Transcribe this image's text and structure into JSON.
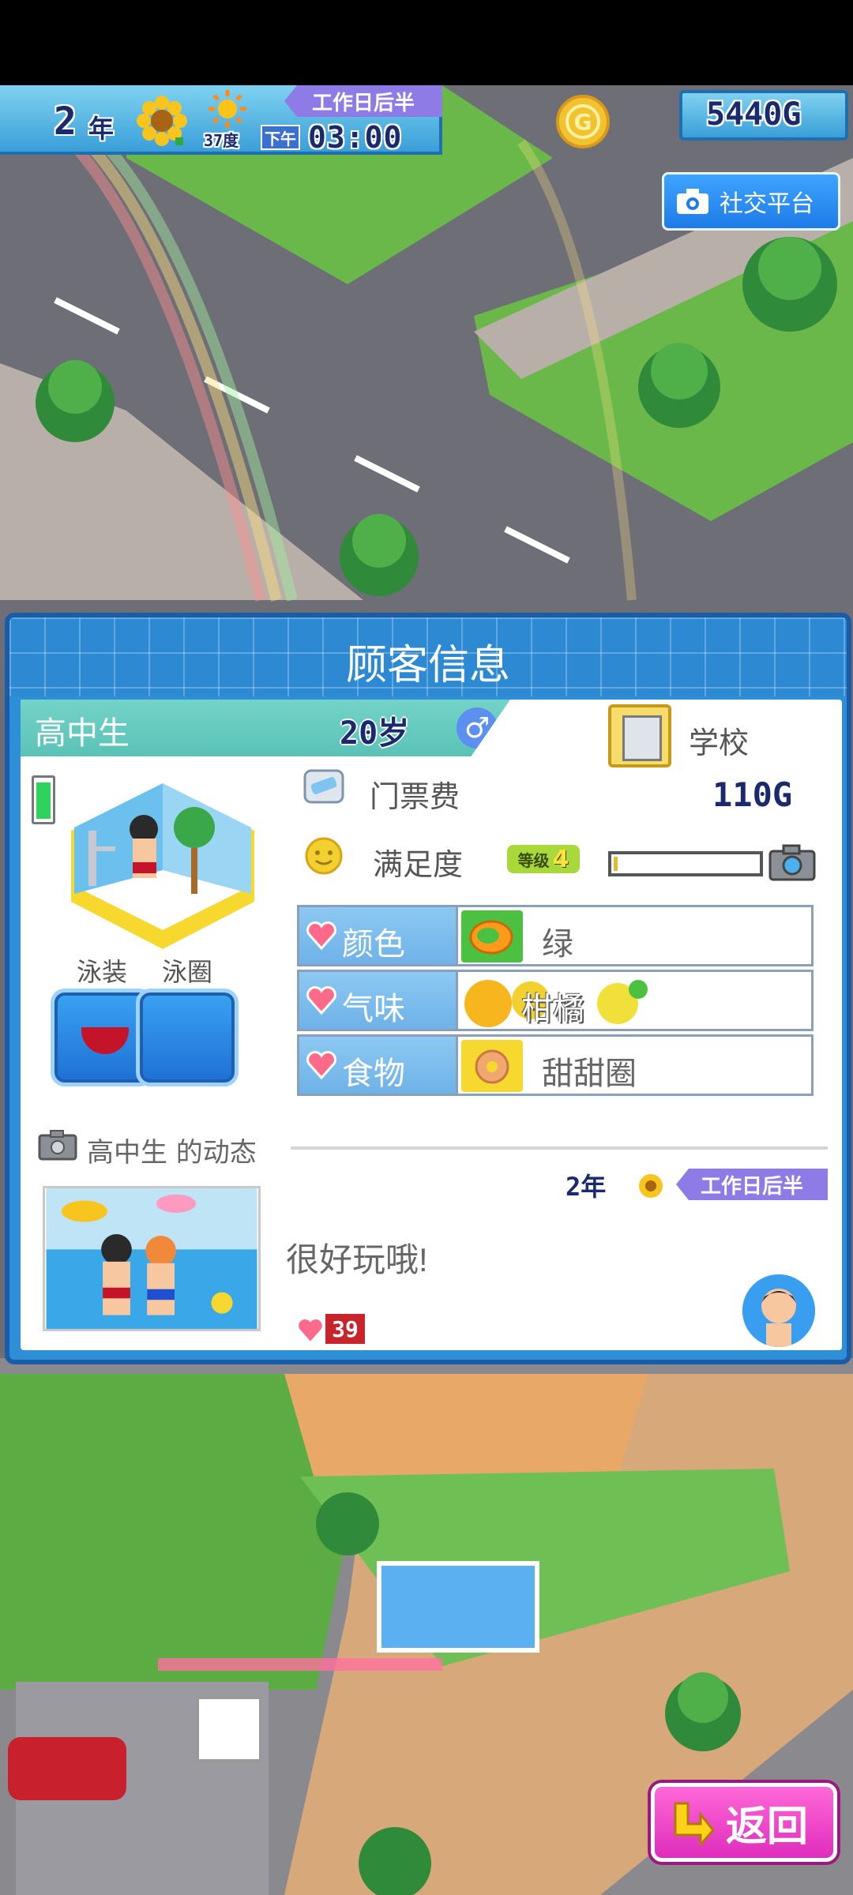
{
  "hud": {
    "year_num": "2",
    "year_unit": "年",
    "temperature": "37度",
    "period": "工作日后半",
    "ampm": "下午",
    "time": "03:00",
    "money": "5440G"
  },
  "social_button_label": "社交平台",
  "dialog": {
    "title": "顾客信息",
    "customer_type": "高中生",
    "age": "20岁",
    "gender_symbol": "♂",
    "home_label": "学校",
    "ticket_label": "门票费",
    "ticket_price": "110G",
    "satisfaction_label": "满足度",
    "level_prefix": "等级",
    "level_value": "4",
    "satisfaction_fraction": 0.03,
    "equipment": [
      {
        "label": "泳装"
      },
      {
        "label": "泳圈"
      }
    ],
    "preferences": [
      {
        "key": "颜色",
        "value": "绿"
      },
      {
        "key": "气味",
        "value": "柑橘"
      },
      {
        "key": "食物",
        "value": "甜甜圈"
      }
    ],
    "activity_title": "高中生 的动态",
    "post": {
      "year": "2年",
      "period": "工作日后半",
      "text": "很好玩哦!",
      "likes": "39"
    }
  },
  "back_button_label": "返回",
  "colors": {
    "dialog_blue": "#2f8fd6",
    "period_purple": "#8e7be6",
    "back_pink": "#e02cbc",
    "name_band_teal": "#5bc2b8"
  },
  "icons": [
    "sunflower-icon",
    "sun-icon",
    "coin-icon",
    "camera-icon",
    "ticket-icon",
    "smiley-icon",
    "heart-icon",
    "school-icon",
    "back-arrow-icon"
  ]
}
